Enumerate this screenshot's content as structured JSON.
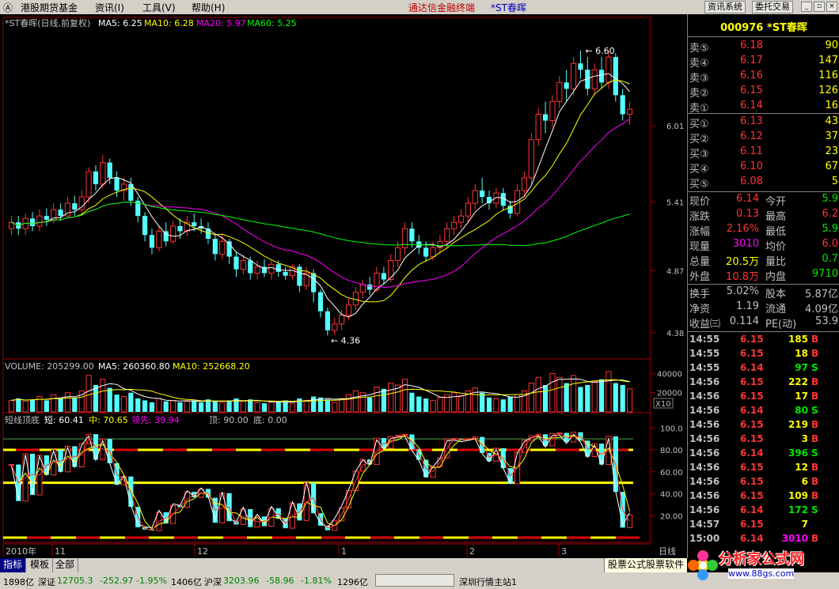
{
  "menu": {
    "items": [
      "Ⓐ",
      "港股期货基金",
      "资讯(I)",
      "工具(V)",
      "帮助(H)"
    ],
    "brand": "通达信金融终端",
    "stock_title": "*ST春晖",
    "btn_info": "资讯系统",
    "btn_trade": "委托交易",
    "win_buttons": [
      "_",
      "▫",
      "×"
    ]
  },
  "colors": {
    "up": "#ff3333",
    "down": "#54ffff",
    "ma5": "#ffffff",
    "ma10": "#ffff00",
    "ma20": "#ff00ff",
    "ma60": "#00ff00"
  },
  "main_header": {
    "name": "*ST春晖(日线,前复权)",
    "ma5": "MA5: 6.25",
    "ma10": "MA10: 6.28",
    "ma20": "MA20: 5.97",
    "ma60": "MA60: 5.25"
  },
  "vol_header": {
    "volume": "VOLUME: 205299.00",
    "ma5": "MA5: 260360.80",
    "ma10": "MA10: 252668.20"
  },
  "ind_header": {
    "name": "短线顶底",
    "short": "短: 60.41",
    "mid": "中: 70.65",
    "lead": "领先: 39.94",
    "top": "顶: 90.00",
    "bottom": "底: 0.00"
  },
  "chart_data": {
    "type": "candlestick",
    "price_axis": {
      "ticks": [
        6.01,
        5.41,
        4.87,
        4.38
      ],
      "min": 4.2,
      "max": 6.75
    },
    "high_annotation": "6.60",
    "low_annotation": "4.36",
    "volume_axis": {
      "ticks": [
        "40000",
        "20000"
      ],
      "unit": "X10"
    },
    "indicator_axis": {
      "ticks": [
        "100.0",
        "80.00",
        "60.00",
        "40.00",
        "20.00"
      ]
    },
    "x_axis": {
      "labels": [
        "2010年",
        "11",
        "12",
        "1",
        "2",
        "3"
      ],
      "period": "日线"
    },
    "candles": [
      [
        5.2,
        5.25,
        5.15,
        5.3
      ],
      [
        5.25,
        5.2,
        5.15,
        5.3
      ],
      [
        5.2,
        5.28,
        5.15,
        5.32
      ],
      [
        5.28,
        5.22,
        5.18,
        5.33
      ],
      [
        5.22,
        5.3,
        5.18,
        5.35
      ],
      [
        5.3,
        5.27,
        5.22,
        5.36
      ],
      [
        5.27,
        5.35,
        5.24,
        5.4
      ],
      [
        5.35,
        5.3,
        5.26,
        5.4
      ],
      [
        5.3,
        5.4,
        5.28,
        5.45
      ],
      [
        5.4,
        5.35,
        5.3,
        5.46
      ],
      [
        5.35,
        5.45,
        5.3,
        5.5
      ],
      [
        5.45,
        5.65,
        5.4,
        5.68
      ],
      [
        5.65,
        5.55,
        5.5,
        5.7
      ],
      [
        5.55,
        5.72,
        5.52,
        5.78
      ],
      [
        5.72,
        5.6,
        5.55,
        5.75
      ],
      [
        5.6,
        5.5,
        5.45,
        5.65
      ],
      [
        5.5,
        5.55,
        5.42,
        5.6
      ],
      [
        5.55,
        5.42,
        5.38,
        5.6
      ],
      [
        5.42,
        5.3,
        5.25,
        5.45
      ],
      [
        5.3,
        5.15,
        5.1,
        5.33
      ],
      [
        5.15,
        5.05,
        5.0,
        5.2
      ],
      [
        5.05,
        5.18,
        5.02,
        5.22
      ],
      [
        5.18,
        5.1,
        5.06,
        5.25
      ],
      [
        5.1,
        5.22,
        5.08,
        5.26
      ],
      [
        5.22,
        5.18,
        5.12,
        5.28
      ],
      [
        5.18,
        5.25,
        5.14,
        5.3
      ],
      [
        5.25,
        5.22,
        5.18,
        5.32
      ],
      [
        5.22,
        5.2,
        5.16,
        5.28
      ],
      [
        5.2,
        5.12,
        5.08,
        5.25
      ],
      [
        5.12,
        5.0,
        4.95,
        5.15
      ],
      [
        5.0,
        5.1,
        4.96,
        5.15
      ],
      [
        5.1,
        4.98,
        4.92,
        5.12
      ],
      [
        4.98,
        4.88,
        4.82,
        5.02
      ],
      [
        4.88,
        4.95,
        4.84,
        5.0
      ],
      [
        4.95,
        4.85,
        4.8,
        4.98
      ],
      [
        4.85,
        4.9,
        4.8,
        4.95
      ],
      [
        4.9,
        4.85,
        4.82,
        4.96
      ],
      [
        4.85,
        4.92,
        4.8,
        4.95
      ],
      [
        4.92,
        4.86,
        4.82,
        4.95
      ],
      [
        4.86,
        4.83,
        4.8,
        4.9
      ],
      [
        4.83,
        4.9,
        4.8,
        4.92
      ],
      [
        4.9,
        4.75,
        4.7,
        4.92
      ],
      [
        4.75,
        4.85,
        4.72,
        4.9
      ],
      [
        4.85,
        4.7,
        4.62,
        4.88
      ],
      [
        4.7,
        4.55,
        4.5,
        4.72
      ],
      [
        4.55,
        4.4,
        4.36,
        4.58
      ],
      [
        4.4,
        4.45,
        4.36,
        4.5
      ],
      [
        4.45,
        4.52,
        4.4,
        4.56
      ],
      [
        4.52,
        4.6,
        4.48,
        4.65
      ],
      [
        4.6,
        4.7,
        4.56,
        4.74
      ],
      [
        4.7,
        4.76,
        4.65,
        4.8
      ],
      [
        4.76,
        4.72,
        4.68,
        4.82
      ],
      [
        4.72,
        4.85,
        4.7,
        4.9
      ],
      [
        4.85,
        4.8,
        4.76,
        4.9
      ],
      [
        4.8,
        4.95,
        4.78,
        5.0
      ],
      [
        4.95,
        5.05,
        4.9,
        5.1
      ],
      [
        5.05,
        5.2,
        5.0,
        5.25
      ],
      [
        5.2,
        5.1,
        5.05,
        5.25
      ],
      [
        5.1,
        5.05,
        5.0,
        5.15
      ],
      [
        5.05,
        4.98,
        4.94,
        5.1
      ],
      [
        4.98,
        5.05,
        4.95,
        5.1
      ],
      [
        5.05,
        5.1,
        5.0,
        5.15
      ],
      [
        5.1,
        5.2,
        5.05,
        5.25
      ],
      [
        5.2,
        5.25,
        5.15,
        5.3
      ],
      [
        5.25,
        5.3,
        5.2,
        5.35
      ],
      [
        5.3,
        5.4,
        5.25,
        5.45
      ],
      [
        5.4,
        5.5,
        5.35,
        5.55
      ],
      [
        5.5,
        5.45,
        5.4,
        5.6
      ],
      [
        5.45,
        5.4,
        5.35,
        5.5
      ],
      [
        5.4,
        5.48,
        5.36,
        5.52
      ],
      [
        5.48,
        5.38,
        5.34,
        5.52
      ],
      [
        5.38,
        5.32,
        5.28,
        5.42
      ],
      [
        5.32,
        5.5,
        5.3,
        5.55
      ],
      [
        5.5,
        5.6,
        5.45,
        5.65
      ],
      [
        5.6,
        5.9,
        5.55,
        5.95
      ],
      [
        5.9,
        6.1,
        5.85,
        6.15
      ],
      [
        6.1,
        6.05,
        5.95,
        6.2
      ],
      [
        6.05,
        6.2,
        6.0,
        6.25
      ],
      [
        6.2,
        6.35,
        6.15,
        6.4
      ],
      [
        6.35,
        6.3,
        6.2,
        6.45
      ],
      [
        6.3,
        6.5,
        6.25,
        6.55
      ],
      [
        6.5,
        6.45,
        6.38,
        6.6
      ],
      [
        6.45,
        6.3,
        6.25,
        6.55
      ],
      [
        6.3,
        6.45,
        6.25,
        6.5
      ],
      [
        6.45,
        6.35,
        6.3,
        6.55
      ],
      [
        6.35,
        6.55,
        6.3,
        6.6
      ],
      [
        6.55,
        6.25,
        6.2,
        6.58
      ],
      [
        6.25,
        6.1,
        6.05,
        6.3
      ],
      [
        6.1,
        6.14,
        6.02,
        6.2
      ]
    ],
    "volumes": [
      12,
      14,
      11,
      13,
      16,
      12,
      18,
      14,
      20,
      15,
      22,
      38,
      28,
      34,
      25,
      18,
      16,
      20,
      14,
      12,
      10,
      14,
      11,
      12,
      10,
      11,
      12,
      10,
      13,
      11,
      10,
      12,
      14,
      11,
      13,
      10,
      9,
      10,
      11,
      12,
      9,
      14,
      12,
      16,
      15,
      13,
      10,
      14,
      18,
      22,
      20,
      15,
      26,
      24,
      30,
      28,
      34,
      20,
      16,
      14,
      12,
      15,
      18,
      20,
      17,
      22,
      25,
      20,
      15,
      14,
      13,
      16,
      18,
      22,
      30,
      36,
      28,
      40,
      36,
      30,
      38,
      26,
      28,
      32,
      34,
      42,
      30,
      28,
      24
    ]
  },
  "panel": {
    "code": "000976",
    "name": "*ST春晖",
    "sells": [
      {
        "label": "卖⑤",
        "price": "6.18",
        "vol": "90"
      },
      {
        "label": "卖④",
        "price": "6.17",
        "vol": "147"
      },
      {
        "label": "卖③",
        "price": "6.16",
        "vol": "116"
      },
      {
        "label": "卖②",
        "price": "6.15",
        "vol": "126"
      },
      {
        "label": "卖①",
        "price": "6.14",
        "vol": "16"
      }
    ],
    "buys": [
      {
        "label": "买①",
        "price": "6.13",
        "vol": "43"
      },
      {
        "label": "买②",
        "price": "6.12",
        "vol": "37"
      },
      {
        "label": "买③",
        "price": "6.11",
        "vol": "23"
      },
      {
        "label": "买④",
        "price": "6.10",
        "vol": "67"
      },
      {
        "label": "买⑤",
        "price": "6.08",
        "vol": "5"
      }
    ],
    "stats": [
      {
        "k1": "现价",
        "v1": "6.14",
        "k2": "今开",
        "v2": "5.9"
      },
      {
        "k1": "涨跌",
        "v1": "0.13",
        "k2": "最高",
        "v2": "6.2"
      },
      {
        "k1": "涨幅",
        "v1": "2.16%",
        "k2": "最低",
        "v2": "5.9"
      },
      {
        "k1": "现量",
        "v1": "3010",
        "k2": "均价",
        "v2": "6.0"
      },
      {
        "k1": "总量",
        "v1": "20.5万",
        "k2": "量比",
        "v2": "0.7"
      },
      {
        "k1": "外盘",
        "v1": "10.8万",
        "k2": "内盘",
        "v2": "9710"
      }
    ],
    "fund": [
      {
        "k1": "换手",
        "v1": "5.02%",
        "k2": "股本",
        "v2": "5.87亿"
      },
      {
        "k1": "净资",
        "v1": "1.19",
        "k2": "流通",
        "v2": "4.09亿"
      },
      {
        "k1": "收益㈢",
        "v1": "0.114",
        "k2": "PE(动)",
        "v2": "53.9"
      }
    ],
    "ticks": [
      {
        "t": "14:55",
        "p": "6.15",
        "v": "185",
        "s": "B"
      },
      {
        "t": "14:55",
        "p": "6.15",
        "v": "18",
        "s": "B"
      },
      {
        "t": "14:55",
        "p": "6.14",
        "v": "97",
        "s": "S"
      },
      {
        "t": "14:56",
        "p": "6.15",
        "v": "222",
        "s": "B"
      },
      {
        "t": "14:56",
        "p": "6.15",
        "v": "17",
        "s": "B"
      },
      {
        "t": "14:56",
        "p": "6.14",
        "v": "80",
        "s": "S"
      },
      {
        "t": "14:56",
        "p": "6.15",
        "v": "219",
        "s": "B"
      },
      {
        "t": "14:56",
        "p": "6.15",
        "v": "3",
        "s": "B"
      },
      {
        "t": "14:56",
        "p": "6.14",
        "v": "396",
        "s": "S"
      },
      {
        "t": "14:56",
        "p": "6.15",
        "v": "12",
        "s": "B"
      },
      {
        "t": "14:56",
        "p": "6.15",
        "v": "6",
        "s": "B"
      },
      {
        "t": "14:56",
        "p": "6.15",
        "v": "109",
        "s": "B"
      },
      {
        "t": "14:56",
        "p": "6.14",
        "v": "172",
        "s": "S"
      },
      {
        "t": "14:57",
        "p": "6.15",
        "v": "7",
        "s": ""
      },
      {
        "t": "15:00",
        "p": "6.14",
        "v": "3010",
        "s": "B"
      }
    ]
  },
  "tabs": [
    "指标",
    "模板",
    "全部"
  ],
  "ad_text": "股票公式股票软件",
  "status": {
    "s1": "1898亿",
    "sz_label": "深证",
    "sz_val": "12705.3",
    "sz_chg": "-252.97",
    "sz_pct": "-1.95%",
    "s2": "1406亿",
    "hs_label": "沪深",
    "hs_val": "3203.96",
    "hs_chg": "-58.96",
    "hs_pct": "-1.81%",
    "s3": "1296亿",
    "station": "深圳行情主站1"
  },
  "watermark": {
    "title": "分析家公式网",
    "url": "www.88gs.com"
  }
}
